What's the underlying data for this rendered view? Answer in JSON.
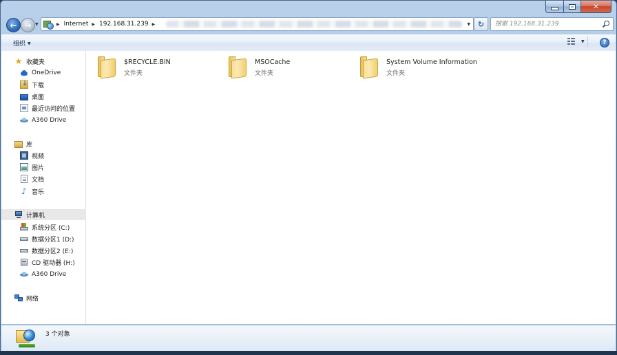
{
  "window": {
    "buttons": {
      "minimize": "minimize",
      "maximize": "maximize",
      "close": "✕"
    }
  },
  "address": {
    "breadcrumbs": [
      "Internet",
      "192.168.31.239"
    ],
    "icon": "network-globe-icon"
  },
  "search": {
    "placeholder": "搜索 192.168.31.239"
  },
  "toolbar": {
    "organize_label": "组织",
    "help_glyph": "?"
  },
  "sidebar": {
    "favorites": {
      "label": "收藏夹",
      "items": [
        {
          "label": "OneDrive",
          "icon": "cloud-icon"
        },
        {
          "label": "下载",
          "icon": "download-icon"
        },
        {
          "label": "桌面",
          "icon": "desktop-icon"
        },
        {
          "label": "最近访问的位置",
          "icon": "recent-places-icon"
        },
        {
          "label": "A360 Drive",
          "icon": "a360-drive-icon"
        }
      ]
    },
    "libraries": {
      "label": "库",
      "items": [
        {
          "label": "视频",
          "icon": "video-icon"
        },
        {
          "label": "图片",
          "icon": "picture-icon"
        },
        {
          "label": "文档",
          "icon": "document-icon"
        },
        {
          "label": "音乐",
          "icon": "music-icon"
        }
      ]
    },
    "computer": {
      "label": "计算机",
      "items": [
        {
          "label": "系统分区 (C:)",
          "icon": "system-drive-icon"
        },
        {
          "label": "数据分区1 (D:)",
          "icon": "drive-icon"
        },
        {
          "label": "数据分区2 (E:)",
          "icon": "drive-icon"
        },
        {
          "label": "CD 驱动器 (H:)",
          "icon": "cd-drive-icon"
        },
        {
          "label": "A360 Drive",
          "icon": "a360-drive-icon"
        }
      ]
    },
    "network": {
      "label": "网络"
    }
  },
  "files": [
    {
      "name": "$RECYCLE.BIN",
      "type": "文件夹"
    },
    {
      "name": "MSOCache",
      "type": "文件夹"
    },
    {
      "name": "System Volume Information",
      "type": "文件夹"
    }
  ],
  "status": {
    "text": "3 个对象"
  },
  "colors": {
    "window_frame": "#a9c4e2",
    "selection": "#e8e8e8",
    "folder": "#f4d98c"
  }
}
